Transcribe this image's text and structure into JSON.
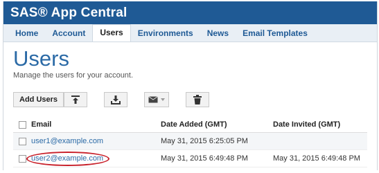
{
  "header": {
    "app_title": "SAS® App Central"
  },
  "nav": {
    "tabs": [
      "Home",
      "Account",
      "Users",
      "Environments",
      "News",
      "Email Templates"
    ],
    "active": "Users"
  },
  "page": {
    "title": "Users",
    "subtitle": "Manage the users for your account."
  },
  "toolbar": {
    "add_users_label": "Add Users",
    "icons": [
      "upload-icon",
      "download-icon",
      "email-dropdown-icon",
      "trash-icon"
    ]
  },
  "table": {
    "columns": [
      "Email",
      "Date Added (GMT)",
      "Date Invited (GMT)"
    ],
    "rows": [
      {
        "email": "user1@example.com",
        "date_added": "May 31, 2015 6:25:05 PM",
        "date_invited": ""
      },
      {
        "email": "user2@example.com",
        "date_added": "May 31, 2015 6:49:48 PM",
        "date_invited": "May 31, 2015 6:49:48 PM"
      }
    ]
  },
  "colors": {
    "brand_bar": "#1f5a95",
    "title_blue": "#2b6aa6",
    "highlight_circle": "#c8202a"
  }
}
